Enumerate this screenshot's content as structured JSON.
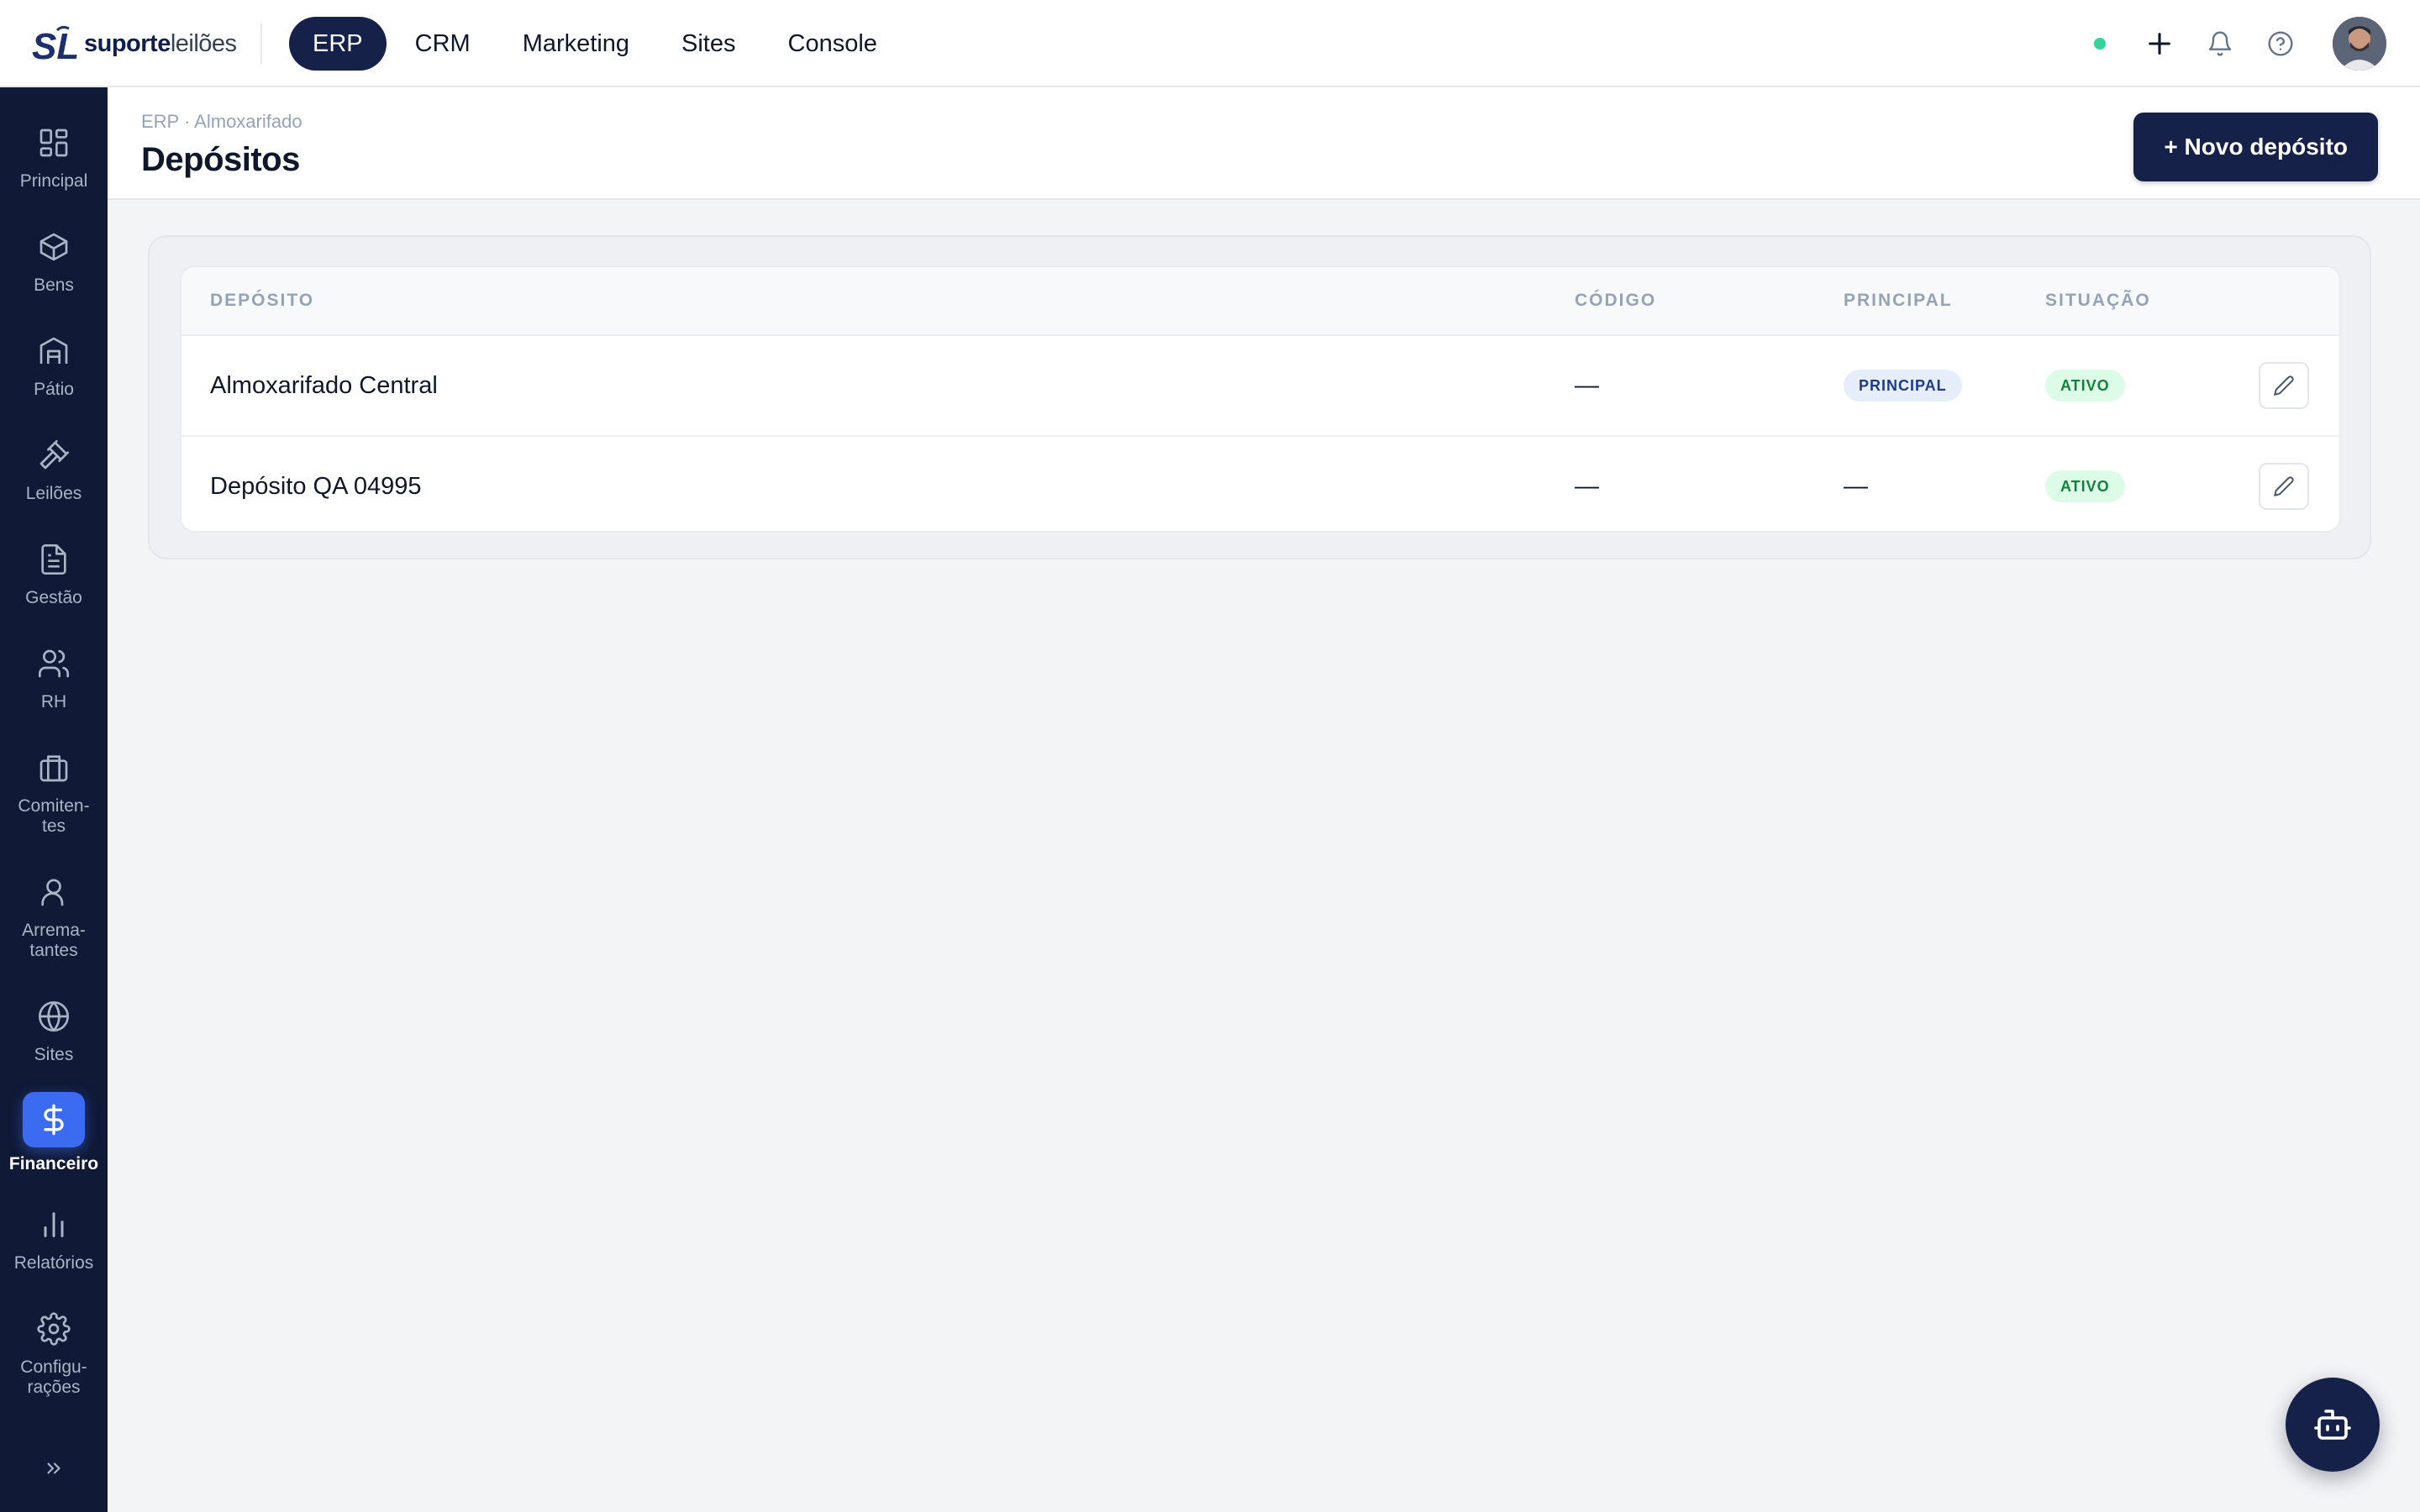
{
  "app": {
    "logo_bold": "suporte",
    "logo_light": "leilões"
  },
  "module_nav": [
    {
      "label": "ERP",
      "active": true
    },
    {
      "label": "CRM",
      "active": false
    },
    {
      "label": "Marketing",
      "active": false
    },
    {
      "label": "Sites",
      "active": false
    },
    {
      "label": "Console",
      "active": false
    }
  ],
  "top_actions": {
    "status": "online",
    "status_color": "#34d399",
    "icons": [
      "plus-icon",
      "bell-icon",
      "help-icon"
    ]
  },
  "sidebar": {
    "items": [
      {
        "label": "Principal",
        "icon": "grid-icon"
      },
      {
        "label": "Bens",
        "icon": "box-icon"
      },
      {
        "label": "Pátio",
        "icon": "warehouse-icon"
      },
      {
        "label": "Leilões",
        "icon": "gavel-icon"
      },
      {
        "label": "Gestão",
        "icon": "document-icon"
      },
      {
        "label": "RH",
        "icon": "users-icon"
      },
      {
        "label": "Comiten-\ntes",
        "icon": "briefcase-icon"
      },
      {
        "label": "Arrema-\ntantes",
        "icon": "user-icon"
      },
      {
        "label": "Sites",
        "icon": "globe-icon"
      },
      {
        "label": "Financeiro",
        "icon": "dollar-icon",
        "active": true
      },
      {
        "label": "Relatórios",
        "icon": "bar-chart-icon"
      },
      {
        "label": "Configu-\nrações",
        "icon": "gear-icon"
      }
    ],
    "active_color": "#3b6bf0"
  },
  "page": {
    "breadcrumb": "ERP · Almoxarifado",
    "title": "Depósitos",
    "new_button": "+ Novo depósito"
  },
  "table": {
    "headers": {
      "deposito": "DEPÓSITO",
      "codigo": "CÓDIGO",
      "principal": "PRINCIPAL",
      "situacao": "SITUAÇÃO"
    },
    "rows": [
      {
        "deposito": "Almoxarifado Central",
        "codigo": "—",
        "principal": "PRINCIPAL",
        "principal_badge": true,
        "situacao": "ATIVO"
      },
      {
        "deposito": "Depósito QA 04995",
        "codigo": "—",
        "principal": "—",
        "principal_badge": false,
        "situacao": "ATIVO"
      }
    ]
  },
  "assistant": {
    "icon": "bot-icon"
  }
}
